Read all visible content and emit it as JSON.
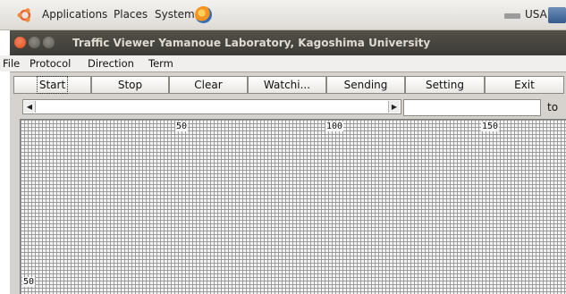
{
  "panel": {
    "applications": "Applications",
    "places": "Places",
    "system": "System",
    "keyboard_layout": "USA",
    "icons": [
      "ubuntu-logo-icon",
      "firefox-icon",
      "keyboard-icon",
      "tray-icon"
    ]
  },
  "window": {
    "title": "Traffic Viewer  Yamanoue Laboratory, Kagoshima University"
  },
  "menubar": {
    "items": [
      "File",
      "Protocol",
      "Direction",
      "Term"
    ]
  },
  "toolbar": {
    "buttons": [
      "Start",
      "Stop",
      "Clear",
      "Watchi...",
      "Sending",
      "Setting",
      "Exit"
    ]
  },
  "range": {
    "to_value": "",
    "to_label": "to"
  },
  "grid": {
    "x_labels": [
      "50",
      "100",
      "150"
    ],
    "y_labels": [
      "50"
    ]
  },
  "colors": {
    "titlebar": "#3c3b37",
    "close_button": "#df4a16",
    "panel_bg": "#dedbd6",
    "grid_line": "#9a9a9a"
  }
}
